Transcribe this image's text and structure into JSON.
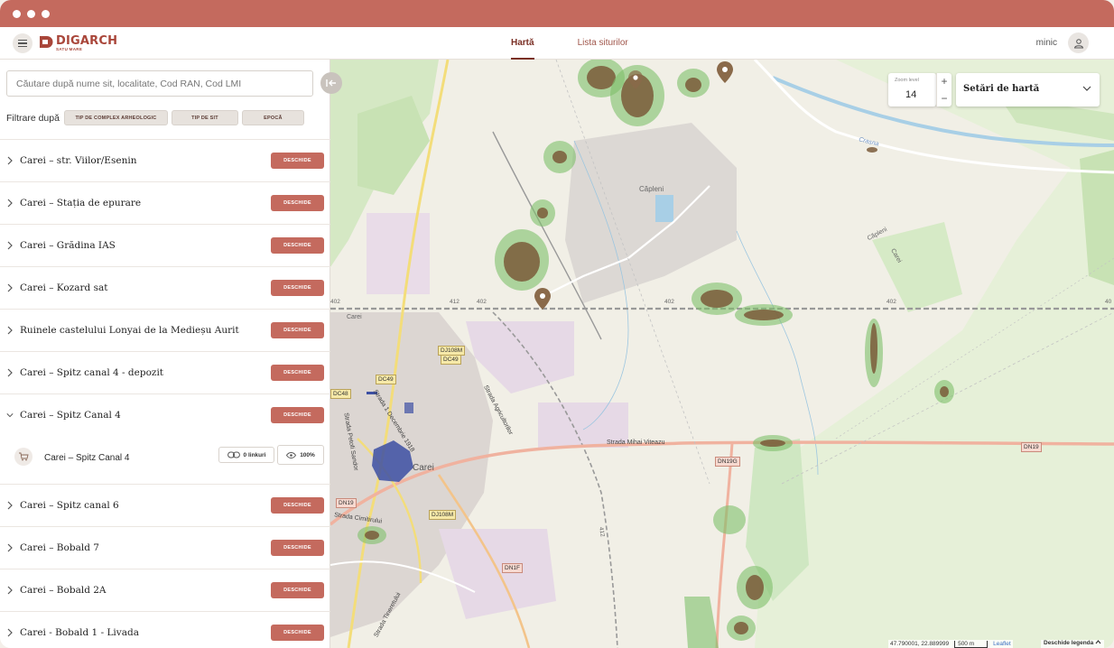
{
  "app": {
    "brand": "DIGARCH",
    "brand_sub": "SATU MARE"
  },
  "nav": {
    "items": [
      {
        "label": "Hartă",
        "active": true
      },
      {
        "label": "Lista siturilor",
        "active": false
      }
    ]
  },
  "user": {
    "name": "minic"
  },
  "search": {
    "placeholder": "Căutare după nume sit, localitate, Cod RAN, Cod LMI",
    "value": ""
  },
  "filters": {
    "label": "Filtrare după",
    "buttons": [
      "TIP DE COMPLEX ARHEOLOGIC",
      "TIP DE SIT",
      "EPOCĂ"
    ]
  },
  "sites": [
    {
      "title": "Carei – str. Viilor/Esenin",
      "button": "DESCHIDE",
      "expanded": false
    },
    {
      "title": "Carei – Stația de epurare",
      "button": "DESCHIDE",
      "expanded": false
    },
    {
      "title": "Carei – Grădina IAS",
      "button": "DESCHIDE",
      "expanded": false
    },
    {
      "title": "Carei – Kozard sat",
      "button": "DESCHIDE",
      "expanded": false
    },
    {
      "title": "Ruinele castelului Lonyai de la Medieșu Aurit",
      "button": "DESCHIDE",
      "expanded": false
    },
    {
      "title": "Carei – Spitz canal 4 - depozit",
      "button": "DESCHIDE",
      "expanded": false
    },
    {
      "title": "Carei – Spitz Canal 4",
      "button": "DESCHIDE",
      "expanded": true
    },
    {
      "title": "Carei – Spitz canal 6",
      "button": "DESCHIDE",
      "expanded": false
    },
    {
      "title": "Carei – Bobald 7",
      "button": "DESCHIDE",
      "expanded": false
    },
    {
      "title": "Carei – Bobald 2A",
      "button": "DESCHIDE",
      "expanded": false
    },
    {
      "title": "Carei - Bobald 1 - Livada",
      "button": "DESCHIDE",
      "expanded": false
    }
  ],
  "expanded_item": {
    "title": "Carei – Spitz Canal 4",
    "links": "0 linkuri",
    "visibility": "100%",
    "icon": "cart-icon"
  },
  "map": {
    "zoom_label": "Zoom level",
    "zoom_value": "14",
    "zoom_in": "+",
    "zoom_out": "−",
    "settings_label": "Setări de hartă",
    "coordinates": "47.790001, 22.889999",
    "scale": "500 m",
    "attribution": "Leaflet",
    "legend_toggle": "Deschide legenda",
    "labels": {
      "capleni": "Căpleni",
      "carei": "Carei",
      "carei_small": "Carei",
      "crasna": "Crasna",
      "strada_mihai": "Strada Mihai Viteazu",
      "strada_petofi": "Strada Petofi Sandor",
      "strada_1dec": "Strada 1 Decembrie 1918",
      "strada_agricult": "Strada Agricultorilor",
      "strada_cimitirului": "Strada Cimitirului",
      "strada_tineretului": "Strada Tineretului",
      "capleni_road": "Căpleni",
      "carei_road": "Carei"
    },
    "shields": {
      "dj108m_top": "DJ108M",
      "dc49_top": "DC49",
      "dc49": "DC49",
      "dn19g": "DN19G",
      "dn19_right": "DN19",
      "dn19_left": "DN19",
      "dj108m_bottom": "DJ108M",
      "dn1f": "DN1F",
      "dc48": "DC48"
    },
    "road_numbers": {
      "r402a": "402",
      "r402b": "402",
      "r402c": "402",
      "r412": "412",
      "r412b": "412",
      "r402d": "402",
      "r40": "40"
    }
  },
  "colors": {
    "accent": "#c46a5e",
    "brand": "#a9463a",
    "site_fill": "#7a5a3a",
    "site_halo": "#7fbf6a",
    "selected": "#3c4fa3"
  }
}
